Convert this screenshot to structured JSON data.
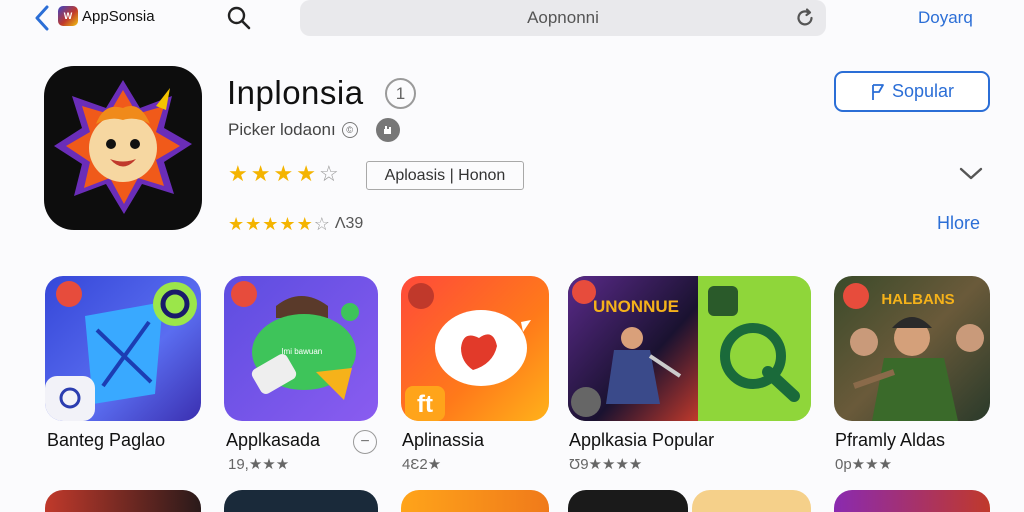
{
  "topbar": {
    "app_name": "AppSonsia",
    "search_text": "Aopnonni",
    "right_link": "Doyarq"
  },
  "app": {
    "title": "Inplonsia",
    "info_symbol": "1",
    "developer": "Picker lodaonı",
    "rating_stars": 4,
    "category_tag": "Aploasis | Honon",
    "rating_count": "Ʌ39",
    "primary_button": "Sopular",
    "more_link": "Hlore"
  },
  "grid": [
    {
      "name": "Banteg Paglao",
      "meta": ""
    },
    {
      "name": "Applkasada",
      "meta": "19,★★★"
    },
    {
      "name": "Aplinassia",
      "meta": "4Ɛ2★"
    },
    {
      "name": "Applkasia Popular",
      "meta": "Ʊ9★★★★",
      "banner": "UNONNUE"
    },
    {
      "name": "Pframly Aldas",
      "meta": "0p★★★",
      "banner": "HALBANS"
    }
  ],
  "colors": {
    "accent": "#2b6ed6",
    "star": "#f4b400",
    "background": "#fbfbfd"
  },
  "icons": [
    "chevron-left-icon",
    "search-icon",
    "reload-icon",
    "info-icon",
    "chevron-down-icon",
    "minus-icon"
  ]
}
